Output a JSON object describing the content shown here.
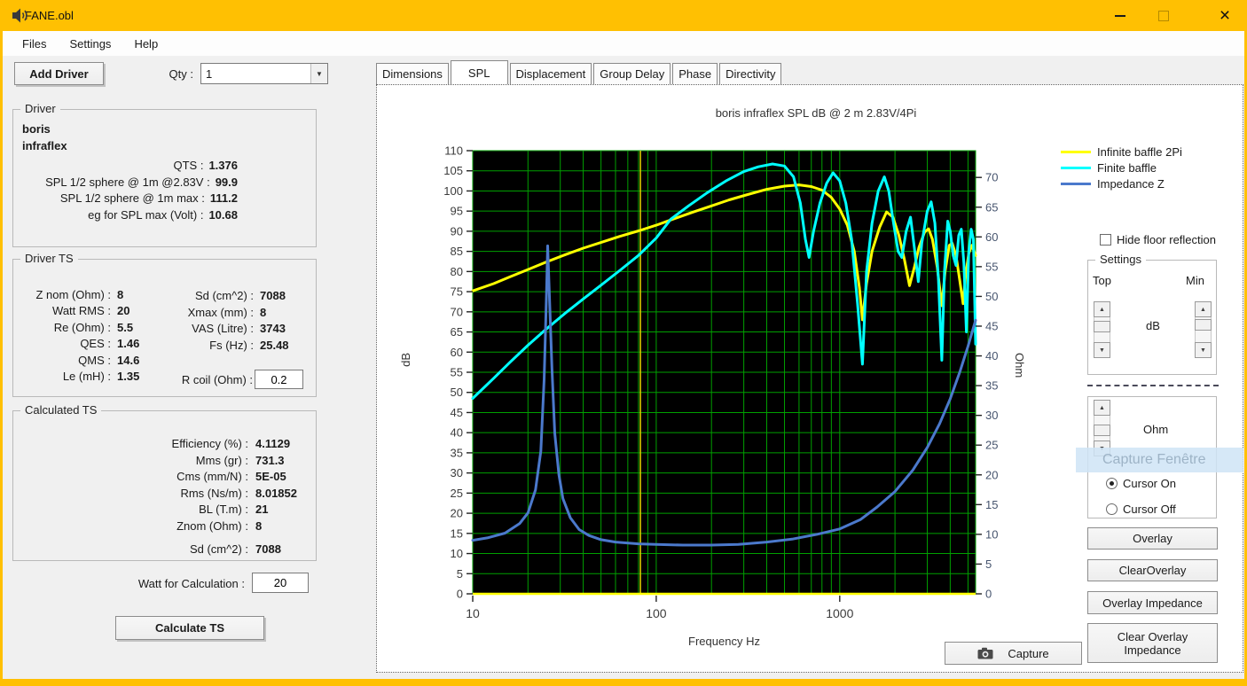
{
  "window": {
    "title": "FANE.obl"
  },
  "menu": {
    "items": [
      "Files",
      "Settings",
      "Help"
    ]
  },
  "toolbar": {
    "add_driver_label": "Add Driver",
    "qty_label": "Qty :",
    "qty_value": "1"
  },
  "left_panel": {
    "driver_box": {
      "title": "Driver",
      "name_line1": "boris",
      "name_line2": "infraflex",
      "rows": [
        {
          "label": "QTS :",
          "value": "1.376"
        },
        {
          "label": "SPL 1/2 sphere @ 1m @2.83V :",
          "value": "99.9"
        },
        {
          "label": "SPL 1/2 sphere @ 1m max :",
          "value": "111.2"
        },
        {
          "label": "eg for SPL max (Volt) :",
          "value": "10.68"
        }
      ]
    },
    "driver_ts": {
      "title": "Driver TS",
      "left_rows": [
        {
          "label": "Z nom (Ohm) :",
          "value": "8"
        },
        {
          "label": "Watt RMS :",
          "value": "20"
        },
        {
          "label": "Re (Ohm) :",
          "value": "5.5"
        },
        {
          "label": "QES :",
          "value": "1.46"
        },
        {
          "label": "QMS :",
          "value": "14.6"
        },
        {
          "label": "Le (mH) :",
          "value": "1.35"
        }
      ],
      "right_rows": [
        {
          "label": "Sd (cm^2) :",
          "value": "7088"
        },
        {
          "label": "Xmax (mm) :",
          "value": "8"
        },
        {
          "label": "VAS (Litre) :",
          "value": "3743"
        },
        {
          "label": "Fs (Hz) :",
          "value": "25.48"
        }
      ],
      "rcoil_label": "R coil (Ohm) :",
      "rcoil_value": "0.2"
    },
    "calculated_ts": {
      "title": "Calculated TS",
      "rows": [
        {
          "label": "Efficiency (%) :",
          "value": "4.1129"
        },
        {
          "label": "Mms (gr) :",
          "value": "731.3"
        },
        {
          "label": "Cms (mm/N) :",
          "value": "5E-05"
        },
        {
          "label": "Rms (Ns/m) :",
          "value": "8.01852"
        },
        {
          "label": "BL (T.m) :",
          "value": "21"
        },
        {
          "label": "Znom (Ohm) :",
          "value": "8"
        },
        {
          "label": "Sd (cm^2) :",
          "value": "7088",
          "gap": true
        }
      ]
    },
    "watt_label": "Watt for Calculation :",
    "watt_value": "20",
    "calculate_button": "Calculate TS"
  },
  "tabs": {
    "items": [
      "Dimensions",
      "SPL",
      "Displacement",
      "Group Delay",
      "Phase",
      "Directivity"
    ],
    "selected_index": 1
  },
  "chart_data": {
    "type": "line",
    "title": "boris infraflex SPL dB @ 2 m 2.83V/4Pi",
    "xlabel": "Frequency Hz",
    "ylabel_left": "dB",
    "ylabel_right": "Ohm",
    "x_scale": "log",
    "x_range": [
      10,
      5500
    ],
    "x_ticks": [
      10,
      100,
      1000
    ],
    "y_left_range": [
      0,
      110
    ],
    "y_left_tick_step": 5,
    "y_right_range": [
      0,
      74.5
    ],
    "y_right_tick_max": 70,
    "y_right_tick_step": 5,
    "background": "#000000",
    "grid_color": "#00a000",
    "x_axis_line_color": "#ffff00",
    "cursor_hz": 82,
    "cursor_color": "#d8c800",
    "legend_position": "top-right-outside",
    "series": [
      {
        "name": "Infinite baffle 2Pi",
        "color": "#ffff00",
        "axis": "left",
        "points": [
          [
            10,
            75.2
          ],
          [
            13,
            77
          ],
          [
            16,
            78.7
          ],
          [
            20,
            80.5
          ],
          [
            25,
            82.3
          ],
          [
            32,
            84.2
          ],
          [
            40,
            85.8
          ],
          [
            50,
            87.2
          ],
          [
            63,
            88.7
          ],
          [
            80,
            90.1
          ],
          [
            100,
            91.5
          ],
          [
            125,
            93.1
          ],
          [
            160,
            94.8
          ],
          [
            200,
            96.3
          ],
          [
            250,
            97.8
          ],
          [
            315,
            99.1
          ],
          [
            400,
            100.4
          ],
          [
            500,
            101.2
          ],
          [
            600,
            101.5
          ],
          [
            700,
            101.1
          ],
          [
            800,
            100.2
          ],
          [
            900,
            98.4
          ],
          [
            1000,
            95.5
          ],
          [
            1100,
            91.5
          ],
          [
            1200,
            85
          ],
          [
            1280,
            76
          ],
          [
            1330,
            68
          ],
          [
            1400,
            77
          ],
          [
            1500,
            85
          ],
          [
            1650,
            91
          ],
          [
            1800,
            94.8
          ],
          [
            1950,
            93.5
          ],
          [
            2100,
            89
          ],
          [
            2250,
            83
          ],
          [
            2400,
            76.5
          ],
          [
            2550,
            81
          ],
          [
            2700,
            86
          ],
          [
            2900,
            89.8
          ],
          [
            3050,
            90.6
          ],
          [
            3200,
            88
          ],
          [
            3400,
            81
          ],
          [
            3600,
            71.5
          ],
          [
            3750,
            80
          ],
          [
            3950,
            86.5
          ],
          [
            4100,
            87
          ],
          [
            4300,
            84
          ],
          [
            4500,
            78
          ],
          [
            4700,
            72
          ],
          [
            4850,
            79
          ],
          [
            5050,
            84.5
          ],
          [
            5250,
            86.5
          ],
          [
            5500,
            84
          ]
        ]
      },
      {
        "name": "Finite baffle",
        "color": "#00ffff",
        "axis": "left",
        "points": [
          [
            10,
            48.5
          ],
          [
            13,
            53.5
          ],
          [
            16,
            57.5
          ],
          [
            20,
            61.7
          ],
          [
            25,
            65.6
          ],
          [
            32,
            69.7
          ],
          [
            40,
            73.2
          ],
          [
            50,
            76.6
          ],
          [
            63,
            80.2
          ],
          [
            80,
            84
          ],
          [
            100,
            88.3
          ],
          [
            120,
            93
          ],
          [
            150,
            96.3
          ],
          [
            190,
            99.6
          ],
          [
            240,
            102.5
          ],
          [
            300,
            104.8
          ],
          [
            360,
            106
          ],
          [
            430,
            106.7
          ],
          [
            500,
            106.2
          ],
          [
            560,
            103.5
          ],
          [
            610,
            97
          ],
          [
            650,
            88
          ],
          [
            680,
            83.5
          ],
          [
            720,
            90
          ],
          [
            780,
            97
          ],
          [
            850,
            102
          ],
          [
            920,
            104.5
          ],
          [
            1000,
            102.5
          ],
          [
            1080,
            97
          ],
          [
            1160,
            88
          ],
          [
            1250,
            72
          ],
          [
            1330,
            57
          ],
          [
            1400,
            80
          ],
          [
            1500,
            92
          ],
          [
            1620,
            100
          ],
          [
            1750,
            103.5
          ],
          [
            1850,
            100
          ],
          [
            1950,
            93
          ],
          [
            2080,
            85
          ],
          [
            2180,
            83.5
          ],
          [
            2300,
            90
          ],
          [
            2430,
            93.5
          ],
          [
            2550,
            86
          ],
          [
            2680,
            77.5
          ],
          [
            2800,
            87
          ],
          [
            3000,
            95
          ],
          [
            3150,
            97.3
          ],
          [
            3300,
            92
          ],
          [
            3450,
            78
          ],
          [
            3600,
            58
          ],
          [
            3720,
            80
          ],
          [
            3880,
            92.5
          ],
          [
            4000,
            90
          ],
          [
            4150,
            84
          ],
          [
            4300,
            81.5
          ],
          [
            4450,
            89
          ],
          [
            4600,
            90.5
          ],
          [
            4750,
            82
          ],
          [
            4900,
            65
          ],
          [
            5050,
            85
          ],
          [
            5200,
            90.5
          ],
          [
            5350,
            88
          ],
          [
            5500,
            62
          ]
        ]
      },
      {
        "name": "Impedance Z",
        "color": "#4b79cc",
        "axis": "right",
        "points": [
          [
            10,
            9
          ],
          [
            12,
            9.4
          ],
          [
            15,
            10.2
          ],
          [
            18,
            11.8
          ],
          [
            20,
            13.6
          ],
          [
            22,
            17.5
          ],
          [
            23.5,
            24
          ],
          [
            24.5,
            36
          ],
          [
            25.2,
            50
          ],
          [
            25.6,
            58.5
          ],
          [
            26.2,
            50
          ],
          [
            27,
            38
          ],
          [
            28,
            27
          ],
          [
            29.5,
            20
          ],
          [
            31,
            16
          ],
          [
            34,
            12.8
          ],
          [
            38,
            10.8
          ],
          [
            43,
            9.8
          ],
          [
            50,
            9.1
          ],
          [
            60,
            8.7
          ],
          [
            80,
            8.4
          ],
          [
            100,
            8.3
          ],
          [
            140,
            8.2
          ],
          [
            200,
            8.2
          ],
          [
            280,
            8.3
          ],
          [
            400,
            8.7
          ],
          [
            550,
            9.2
          ],
          [
            750,
            10
          ],
          [
            1000,
            10.9
          ],
          [
            1300,
            12.5
          ],
          [
            1600,
            14.6
          ],
          [
            2000,
            17.2
          ],
          [
            2500,
            20.8
          ],
          [
            3000,
            24.6
          ],
          [
            3500,
            28.6
          ],
          [
            4000,
            32.8
          ],
          [
            4500,
            37.2
          ],
          [
            5000,
            41.6
          ],
          [
            5500,
            46
          ]
        ]
      }
    ]
  },
  "right_panel": {
    "hide_floor_label": "Hide  floor reflection",
    "settings": {
      "title": "Settings",
      "top_label": "Top",
      "min_label": "Min",
      "db_label": "dB",
      "ohm_label": "Ohm"
    },
    "ghost_text": "Capture Fenêtre",
    "cursor_on_label": "Cursor On",
    "cursor_off_label": "Cursor Off",
    "buttons": [
      "Overlay",
      "ClearOverlay",
      "Overlay Impedance",
      "Clear Overlay Impedance"
    ],
    "capture_label": "Capture"
  }
}
